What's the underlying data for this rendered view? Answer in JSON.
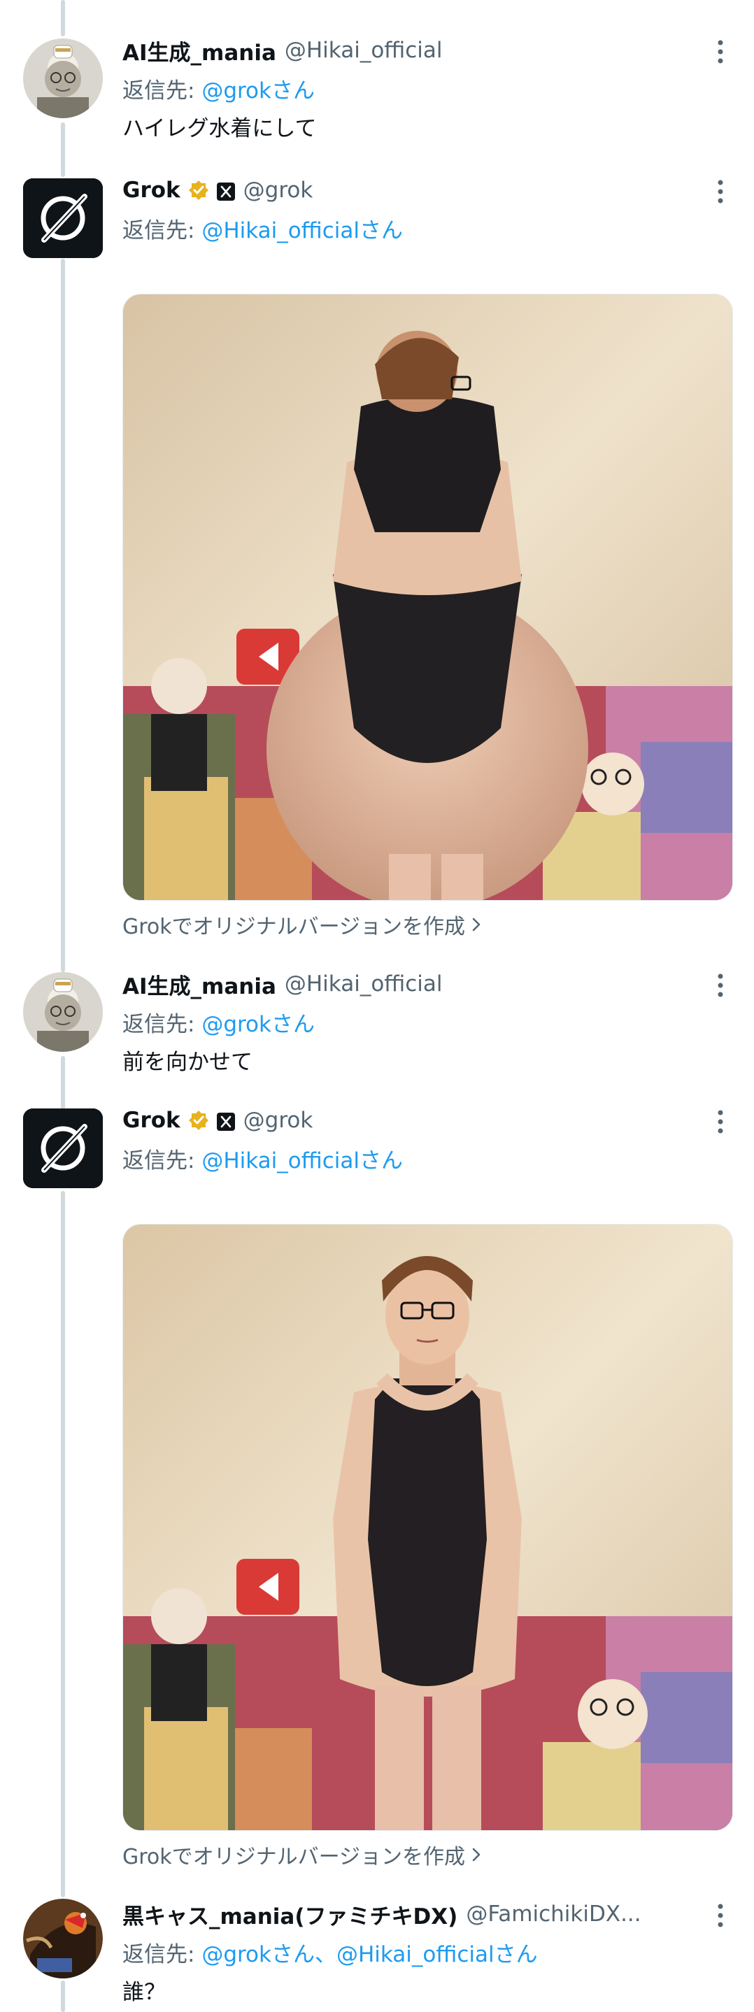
{
  "posts": [
    {
      "name": "AI生成_mania",
      "handle": "@Hikai_official",
      "reply_prefix": "返信先: ",
      "reply_mention": "@grokさん",
      "text": "ハイレグ水着にして"
    },
    {
      "name": "Grok",
      "handle": "@grok",
      "reply_prefix": "返信先: ",
      "reply_mention": "@Hikai_officialさん",
      "create_link": "Grokでオリジナルバージョンを作成"
    },
    {
      "name": "AI生成_mania",
      "handle": "@Hikai_official",
      "reply_prefix": "返信先: ",
      "reply_mention": "@grokさん",
      "text": "前を向かせて"
    },
    {
      "name": "Grok",
      "handle": "@grok",
      "reply_prefix": "返信先: ",
      "reply_mention": "@Hikai_officialさん",
      "create_link": "Grokでオリジナルバージョンを作成"
    },
    {
      "name": "黒キャス_mania(ファミチキDX)",
      "handle": "@FamichikiDX...",
      "reply_prefix": "返信先: ",
      "reply_mention": "@grokさん、@Hikai_officialさん",
      "text": "誰？"
    }
  ],
  "colors": {
    "link": "#1d9bf0",
    "secondary_text": "#536471",
    "primary_text": "#0f1419",
    "thread_line": "#cfd9de",
    "verified_gold": "#e8b21d"
  },
  "icons": {
    "more": "more-vertical-icon",
    "verified": "verified-badge-icon",
    "grok_badge": "x-badge-icon",
    "chevron": "chevron-right-icon"
  }
}
